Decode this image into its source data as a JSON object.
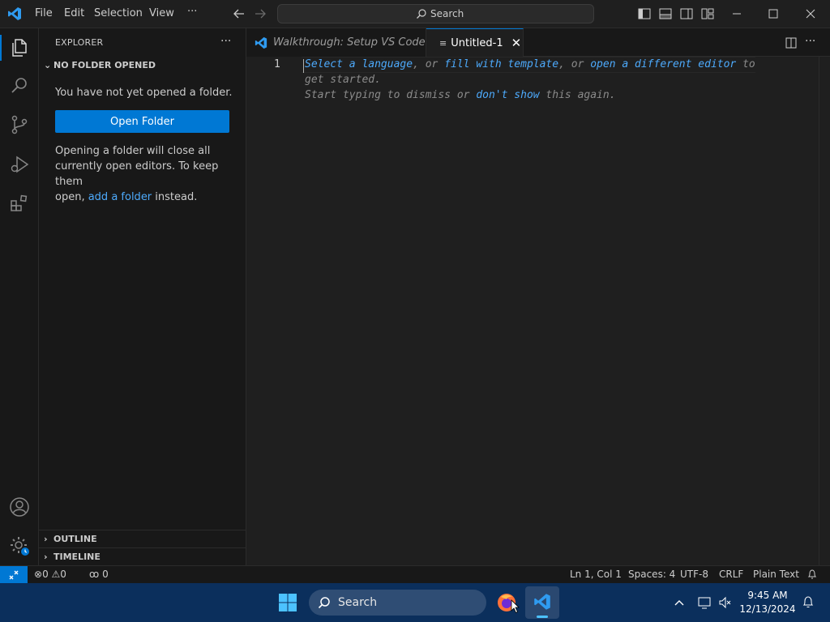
{
  "menu": {
    "file": "File",
    "edit": "Edit",
    "selection": "Selection",
    "view": "View",
    "more": "···"
  },
  "command_center": {
    "label": "Search"
  },
  "sidebar": {
    "title": "EXPLORER",
    "section": "NO FOLDER OPENED",
    "message": "You have not yet opened a folder.",
    "open_folder": "Open Folder",
    "note_1": "Opening a folder will close all",
    "note_2": "currently open editors. To keep them",
    "note_3a": "open, ",
    "note_3_link": "add a folder",
    "note_3b": " instead.",
    "outline": "OUTLINE",
    "timeline": "TIMELINE"
  },
  "tabs": [
    {
      "label": "Walkthrough: Setup VS Code"
    },
    {
      "label": "Untitled-1"
    }
  ],
  "editor": {
    "line_number": "1",
    "l1_a": "Select a language",
    "l1_b": ", or ",
    "l1_c": "fill with template",
    "l1_d": ", or ",
    "l1_e": "open a different editor",
    "l1_f": " to",
    "l2": "get started.",
    "l3_a": "Start typing to dismiss or ",
    "l3_b": "don't show",
    "l3_c": " this again."
  },
  "status": {
    "errors": "0",
    "warnings": "0",
    "ports": "0",
    "position": "Ln 1, Col 1",
    "spaces": "Spaces: 4",
    "encoding": "UTF-8",
    "eol": "CRLF",
    "language": "Plain Text"
  },
  "taskbar": {
    "search": "Search",
    "time": "9:45 AM",
    "date": "12/13/2024"
  },
  "colors": {
    "accent": "#0078d4",
    "link": "#4daafc",
    "taskbar": "#0b2f5c"
  }
}
